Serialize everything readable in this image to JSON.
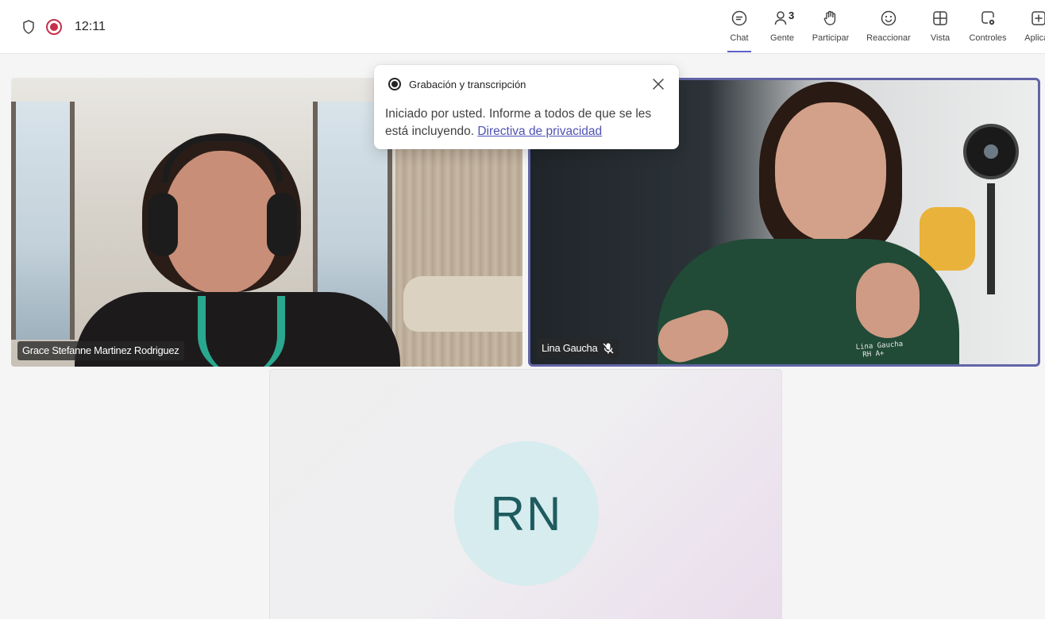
{
  "status": {
    "time": "12:11"
  },
  "toolbar": {
    "chat_label": "Chat",
    "people_label": "Gente",
    "people_count": "3",
    "raise_hand_label": "Participar",
    "react_label": "Reaccionar",
    "view_label": "Vista",
    "controls_label": "Controles",
    "apps_label": "Aplicac"
  },
  "recording_popover": {
    "title": "Grabación y transcripción",
    "message": "Iniciado por usted. Informe a todos de que se les está incluyendo.",
    "link_text": "Directiva de privacidad"
  },
  "participants": [
    {
      "name": "Grace Stefanne Martinez Rodriguez"
    },
    {
      "name": "Lina Gaucha"
    },
    {
      "initials": "RN"
    }
  ],
  "uniform_text": [
    "Lina Gaucha",
    "RH A+"
  ],
  "colors": {
    "accent": "#5b5fc7",
    "recording": "#c4314b",
    "avatar_bg": "#d6ecee",
    "avatar_text": "#1e5b5e"
  }
}
